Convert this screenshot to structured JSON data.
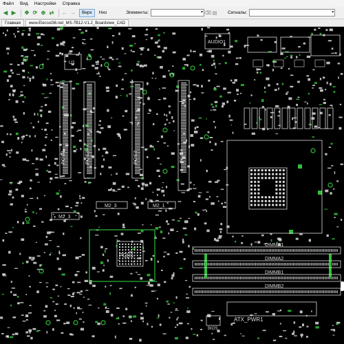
{
  "menu": {
    "items": [
      "Файл",
      "Вид",
      "Настройки",
      "Справка"
    ]
  },
  "toolbar": {
    "view_toggle": "Верх",
    "bottom_toggle": "Низ",
    "elements_label": "Элементы:",
    "signals_label": "Сигналы:",
    "elements_value": "",
    "signals_value": ""
  },
  "tabs": [
    {
      "label": "Главная",
      "active": false
    },
    {
      "label": "www.Elecsol36.net_MS-7B12-V1.2_Boardview_CAD",
      "active": true
    }
  ],
  "board": {
    "labels": {
      "audio1": "AUDIO1",
      "u1": "U1",
      "pcie1": "PCIE1",
      "pcie2": "PCIE2",
      "pcie3": "PCIE3",
      "pcie4": "PCIE4",
      "m2_3a": "M2_3",
      "m2_3b": "M2_3",
      "m2_1": "M2_1",
      "pch1": "PCH1",
      "dimma1": "DIMMA1",
      "dimma2": "DIMMA2",
      "dimmb1": "DIMMB1",
      "dimmb2": "DIMMB2",
      "atx_pwr1": "ATX_PWR1",
      "bios": "BIOS"
    },
    "colors": {
      "background": "#000000",
      "silkscreen": "#dcdcdc",
      "pad_green": "#2fbf3a"
    }
  }
}
